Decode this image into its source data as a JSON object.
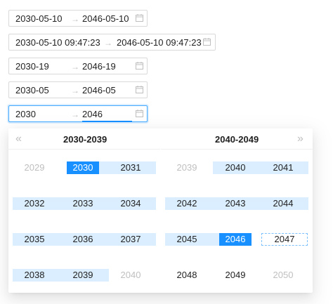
{
  "pickers": [
    {
      "start": "2030-05-10",
      "end": "2046-05-10",
      "separator": "→"
    },
    {
      "start": "2030-05-10 09:47:23",
      "end": "2046-05-10 09:47:23",
      "separator": "→"
    },
    {
      "start": "2030-19",
      "end": "2046-19",
      "separator": "→"
    },
    {
      "start": "2030-05",
      "end": "2046-05",
      "separator": "→"
    },
    {
      "start": "2030",
      "end": "2046",
      "separator": "→"
    }
  ],
  "dropdown": {
    "prev_label": "«",
    "next_label": "»",
    "left_title": "2030-2039",
    "right_title": "2040-2049",
    "left_years": [
      "2029",
      "2030",
      "2031",
      "2032",
      "2033",
      "2034",
      "2035",
      "2036",
      "2037",
      "2038",
      "2039",
      "2040"
    ],
    "right_years": [
      "2039",
      "2040",
      "2041",
      "2042",
      "2043",
      "2044",
      "2045",
      "2046",
      "2047",
      "2048",
      "2049",
      "2050"
    ]
  },
  "colors": {
    "accent": "#1890ff",
    "range": "#dbeeff",
    "muted": "#bfbfbf"
  },
  "icons": {
    "calendar": "calendar-icon",
    "prev": "double-left-icon",
    "next": "double-right-icon"
  }
}
